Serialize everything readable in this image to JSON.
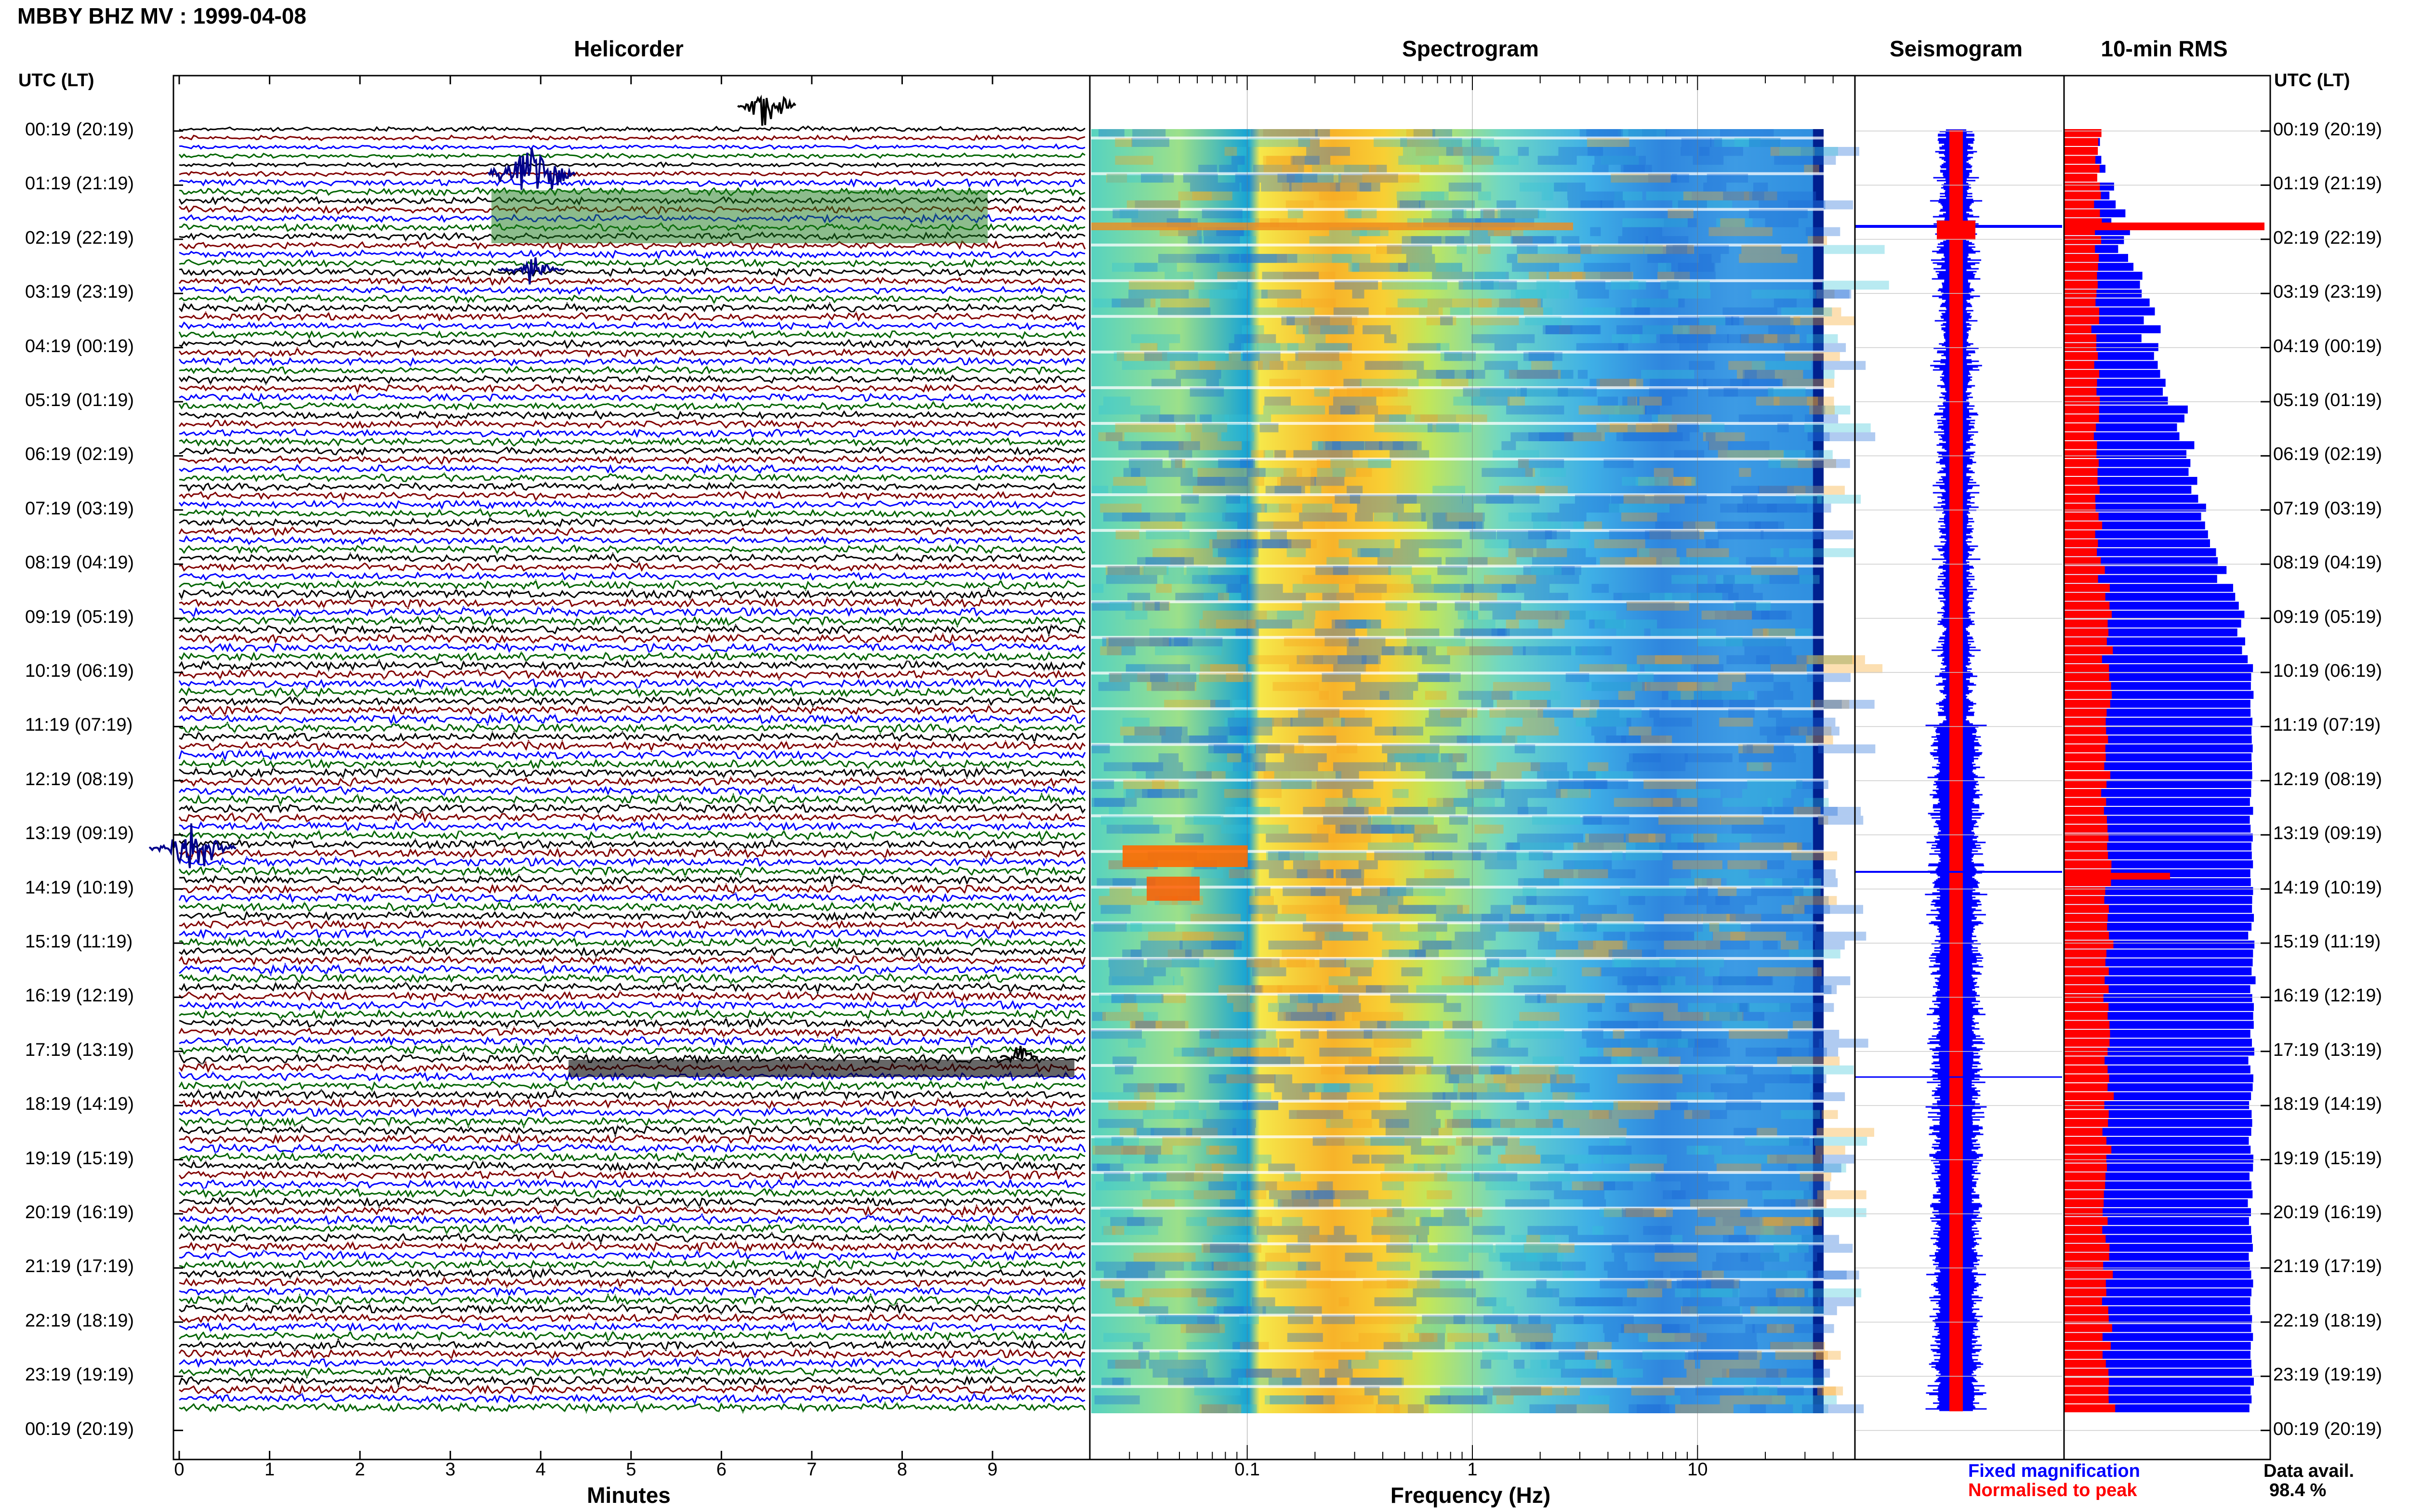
{
  "header": {
    "title": "MBBY BHZ MV : 1999-04-08"
  },
  "panels": {
    "helicorder": "Helicorder",
    "spectrogram": "Spectrogram",
    "seismogram": "Seismogram",
    "rms": "10-min RMS"
  },
  "axis": {
    "left_header": "UTC (LT)",
    "right_header": "UTC (LT)",
    "helicorder_xlabel": "Minutes",
    "spectrogram_xlabel": "Frequency (Hz)",
    "minute_ticks": [
      "0",
      "1",
      "2",
      "3",
      "4",
      "5",
      "6",
      "7",
      "8",
      "9"
    ],
    "freq_ticks": [
      "0.1",
      "1",
      "10"
    ]
  },
  "time_labels": [
    "00:19 (20:19)",
    "01:19 (21:19)",
    "02:19 (22:19)",
    "03:19 (23:19)",
    "04:19 (00:19)",
    "05:19 (01:19)",
    "06:19 (02:19)",
    "07:19 (03:19)",
    "08:19 (04:19)",
    "09:19 (05:19)",
    "10:19 (06:19)",
    "11:19 (07:19)",
    "12:19 (08:19)",
    "13:19 (09:19)",
    "14:19 (10:19)",
    "15:19 (11:19)",
    "16:19 (12:19)",
    "17:19 (13:19)",
    "18:19 (14:19)",
    "19:19 (15:19)",
    "20:19 (16:19)",
    "21:19 (17:19)",
    "22:19 (18:19)",
    "23:19 (19:19)",
    "00:19 (20:19)"
  ],
  "legend": {
    "fixed": "Fixed magnification",
    "normalised": "Normalised to peak",
    "avail_label": "Data avail.",
    "avail_value": "98.4 %",
    "colors": {
      "fixed": "#0000ff",
      "normalised": "#ff0000"
    }
  },
  "chart_data": {
    "type": "heatmap",
    "title": "MBBY BHZ MV : 1999-04-08",
    "xlabel": "Frequency (Hz)",
    "x_scale": "log",
    "xlim": [
      0.02,
      50
    ],
    "ylabel": "UTC (LT)",
    "helicorder": {
      "xlabel": "Minutes",
      "xlim": [
        0,
        10
      ],
      "trace_colors": [
        "#000000",
        "#800000",
        "#0000ff",
        "#006400"
      ],
      "events": [
        {
          "time": "00:19",
          "minute": 6.5,
          "color": "black"
        },
        {
          "time": "01:00",
          "minute": 3.9,
          "color": "blue"
        },
        {
          "time": "13:10",
          "minute": 0.3,
          "color": "blue"
        },
        {
          "time": "17:30",
          "minute": 4.5,
          "color": "black"
        },
        {
          "time": "17:30",
          "minute": 9.3,
          "color": "black"
        }
      ]
    },
    "rms": {
      "series": [
        {
          "name": "Fixed magnification",
          "color": "#0000ff"
        },
        {
          "name": "Normalised to peak",
          "color": "#ff0000"
        }
      ]
    },
    "data_available_percent": 98.4
  }
}
